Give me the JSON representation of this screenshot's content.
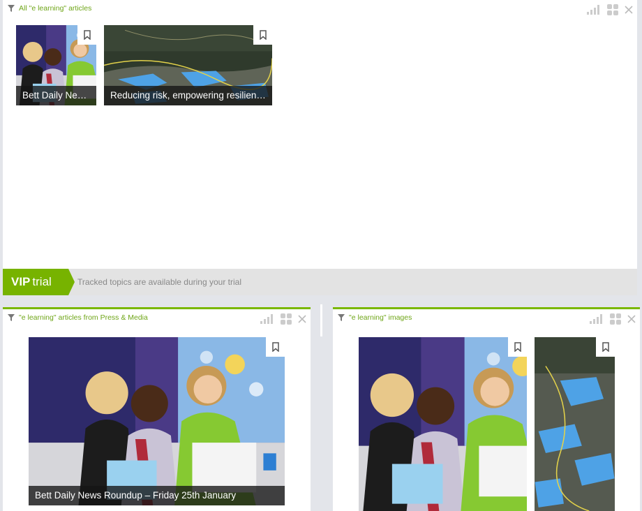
{
  "top_panel": {
    "title": "All \"e learning\" articles",
    "articles": [
      {
        "caption": "Bett Daily News..."
      },
      {
        "caption": "Reducing risk, empowering resilienc..."
      }
    ]
  },
  "vip_banner": {
    "badge_bold": "VIP",
    "badge_text": "trial",
    "message": "Tracked topics are available during your trial"
  },
  "left_panel": {
    "title": "\"e learning\" articles from Press & Media",
    "articles": [
      {
        "caption": "Bett Daily News Roundup – Friday 25th January"
      }
    ]
  },
  "right_panel": {
    "title": "\"e learning\" images"
  },
  "icons": {
    "filter": "filter-icon",
    "signal": "signal-bars-icon",
    "grid": "grid-view-icon",
    "close": "close-icon",
    "bookmark": "bookmark-icon"
  },
  "colors": {
    "accent_green": "#7ab800",
    "title_green": "#6ea517",
    "background": "#e3e5ea"
  }
}
